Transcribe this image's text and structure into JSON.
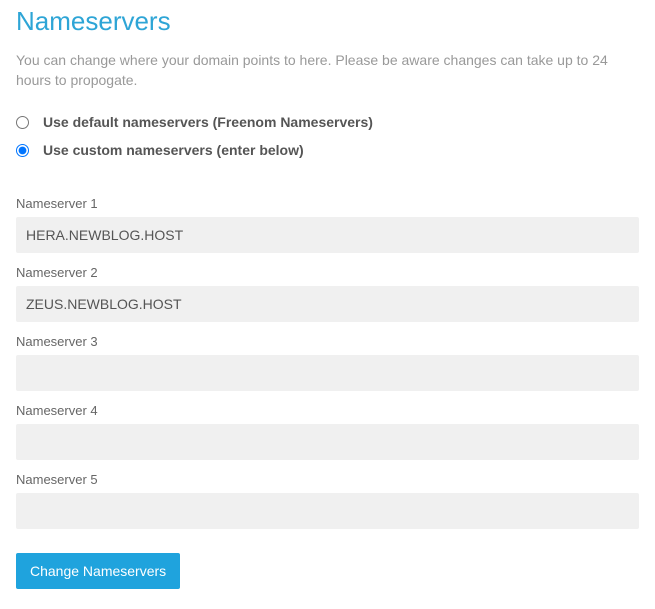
{
  "header": {
    "title": "Nameservers",
    "description": "You can change where your domain points to here. Please be aware changes can take up to 24 hours to propogate."
  },
  "options": {
    "default_label": "Use default nameservers (Freenom Nameservers)",
    "custom_label": "Use custom nameservers (enter below)"
  },
  "nameservers": [
    {
      "label": "Nameserver 1",
      "value": "HERA.NEWBLOG.HOST"
    },
    {
      "label": "Nameserver 2",
      "value": "ZEUS.NEWBLOG.HOST"
    },
    {
      "label": "Nameserver 3",
      "value": ""
    },
    {
      "label": "Nameserver 4",
      "value": ""
    },
    {
      "label": "Nameserver 5",
      "value": ""
    }
  ],
  "submit_label": "Change Nameservers"
}
